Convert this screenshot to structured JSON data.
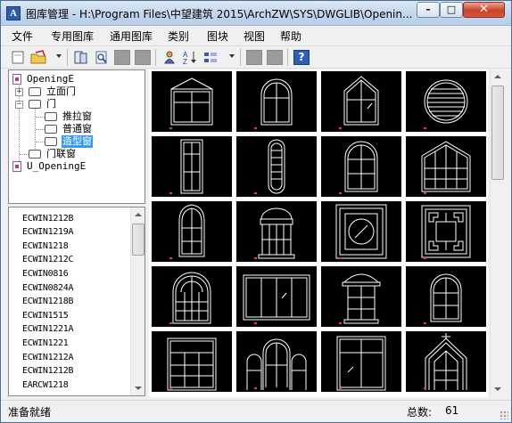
{
  "window": {
    "title": "图库管理 - H:\\Program Files\\中望建筑 2015\\ArchZW\\SYS\\DWGLIB\\Openin..."
  },
  "titlebar_buttons": {
    "minimize": "–",
    "maximize": "□",
    "close": "✕"
  },
  "menu": [
    "文件",
    "专用图库",
    "通用图库",
    "类别",
    "图块",
    "视图",
    "帮助"
  ],
  "toolbar_icons": [
    "new-file-icon",
    "open-folder-icon",
    "dropdown-icon",
    "library-icon",
    "search-file-icon",
    "disabled-icon",
    "disabled-icon",
    "person-icon",
    "sort-az-icon",
    "view-list-icon",
    "dropdown-icon",
    "disabled-icon",
    "disabled-icon",
    "help-icon"
  ],
  "toolbar_help": "?",
  "tree": {
    "items": [
      {
        "label": "OpeningE",
        "level": 0
      },
      {
        "label": "立面门",
        "level": 1
      },
      {
        "label": "门",
        "level": 1
      },
      {
        "label": "推拉窗",
        "level": 2
      },
      {
        "label": "普通窗",
        "level": 2
      },
      {
        "label": "造型窗",
        "level": 2,
        "selected": true
      },
      {
        "label": "门联窗",
        "level": 1
      },
      {
        "label": "U_OpeningE",
        "level": 0
      }
    ]
  },
  "list": {
    "items": [
      "ECWIN1212B",
      "ECWIN1219A",
      "ECWIN1218",
      "ECWIN1212C",
      "ECWIN0816",
      "ECWIN0824A",
      "ECWIN1218B",
      "ECWIN1515",
      "ECWIN1221A",
      "ECWIN1221",
      "ECWIN1212A",
      "ECWIN1212B",
      "EARCW1218"
    ]
  },
  "preview": {
    "thumbnails": [
      "arched-gable-window",
      "arched-double-window",
      "gothic-window",
      "louvered-round-window",
      "tall-panel-window",
      "oval-window",
      "arched-grid-window",
      "gable-grid-window",
      "pointed-arch-window",
      "colonial-window",
      "square-circle-window",
      "chinese-lattice-window",
      "rounded-arch-grid-window",
      "sliding-panel-window",
      "pediment-window",
      "arched-grid-window-2",
      "transom-grid-window",
      "triple-arch-window",
      "transom-pane-window",
      "gothic-trim-window"
    ]
  },
  "status": {
    "left": "准备就绪",
    "count_label": "总数:",
    "count_value": "61"
  }
}
